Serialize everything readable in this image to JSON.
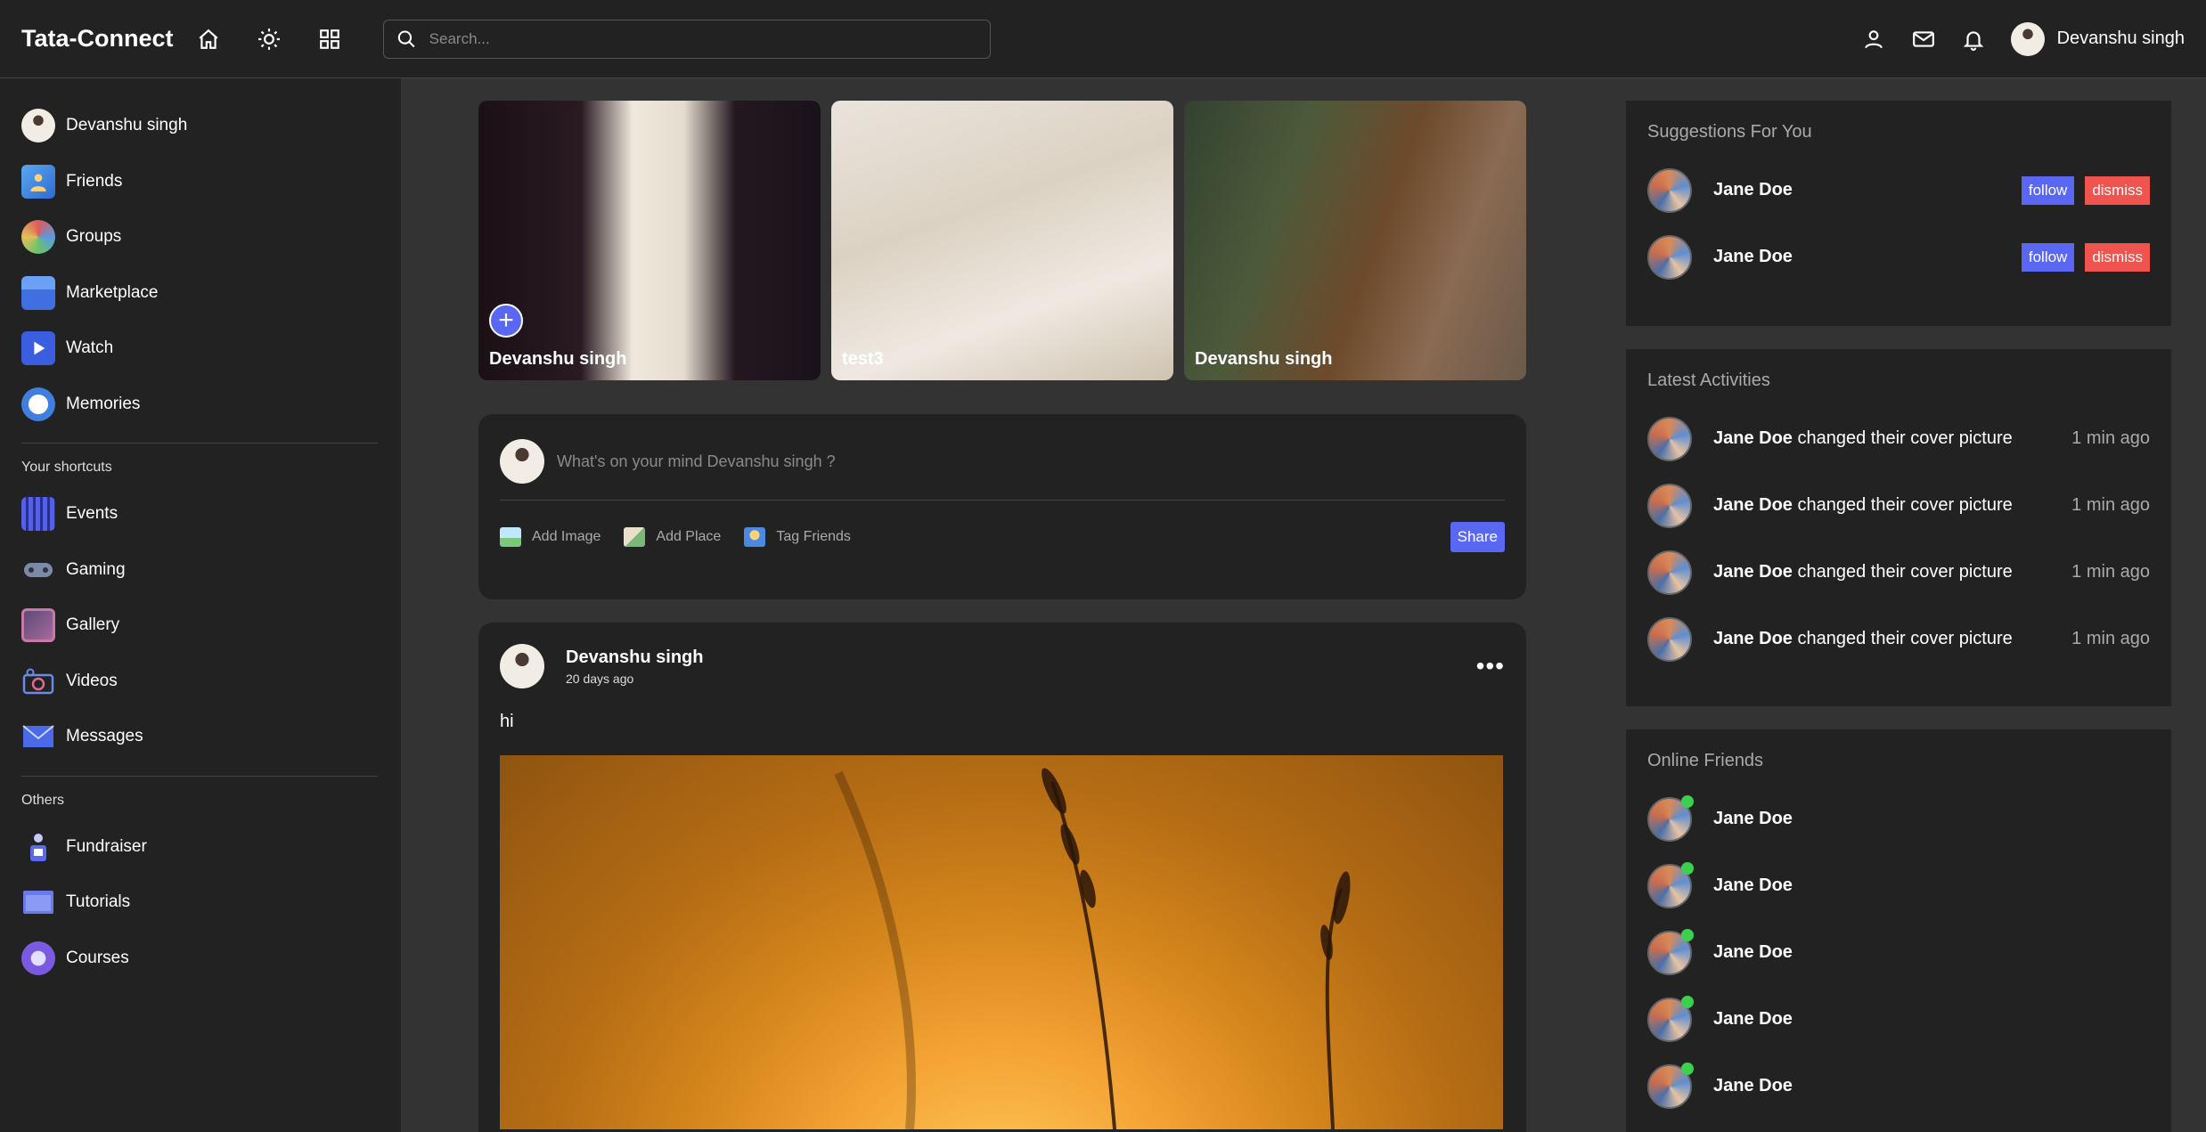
{
  "navbar": {
    "logo": "Tata-Connect",
    "search_placeholder": "Search...",
    "user_name": "Devanshu singh",
    "icons": [
      "home-icon",
      "sun-icon",
      "grid-icon",
      "search-icon",
      "person-icon",
      "mail-icon",
      "bell-icon"
    ]
  },
  "sidebar": {
    "top_items": [
      {
        "label": "Devanshu singh",
        "icon": "avatar"
      },
      {
        "label": "Friends",
        "icon": "friends-icon"
      },
      {
        "label": "Groups",
        "icon": "groups-icon"
      },
      {
        "label": "Marketplace",
        "icon": "marketplace-icon"
      },
      {
        "label": "Watch",
        "icon": "watch-icon"
      },
      {
        "label": "Memories",
        "icon": "memories-icon"
      }
    ],
    "shortcuts_title": "Your shortcuts",
    "shortcuts": [
      {
        "label": "Events",
        "icon": "events-icon"
      },
      {
        "label": "Gaming",
        "icon": "gaming-icon"
      },
      {
        "label": "Gallery",
        "icon": "gallery-icon"
      },
      {
        "label": "Videos",
        "icon": "videos-icon"
      },
      {
        "label": "Messages",
        "icon": "messages-icon"
      }
    ],
    "others_title": "Others",
    "others": [
      {
        "label": "Fundraiser",
        "icon": "fundraiser-icon"
      },
      {
        "label": "Tutorials",
        "icon": "tutorials-icon"
      },
      {
        "label": "Courses",
        "icon": "courses-icon"
      }
    ]
  },
  "stories": [
    {
      "name": "Devanshu singh"
    },
    {
      "name": "test3"
    },
    {
      "name": "Devanshu singh"
    }
  ],
  "composer": {
    "placeholder": "What's on your mind Devanshu singh ?",
    "add_image": "Add Image",
    "add_place": "Add Place",
    "tag_friends": "Tag Friends",
    "share": "Share"
  },
  "post": {
    "author": "Devanshu singh",
    "date": "20 days ago",
    "text": "hi",
    "more": "•••"
  },
  "suggestions": {
    "title": "Suggestions For You",
    "items": [
      {
        "name": "Jane Doe",
        "follow": "follow",
        "dismiss": "dismiss"
      },
      {
        "name": "Jane Doe",
        "follow": "follow",
        "dismiss": "dismiss"
      }
    ]
  },
  "activities": {
    "title": "Latest Activities",
    "items": [
      {
        "name": "Jane Doe",
        "action": "changed their cover picture",
        "time": "1 min ago"
      },
      {
        "name": "Jane Doe",
        "action": "changed their cover picture",
        "time": "1 min ago"
      },
      {
        "name": "Jane Doe",
        "action": "changed their cover picture",
        "time": "1 min ago"
      },
      {
        "name": "Jane Doe",
        "action": "changed their cover picture",
        "time": "1 min ago"
      }
    ]
  },
  "online": {
    "title": "Online Friends",
    "items": [
      {
        "name": "Jane Doe"
      },
      {
        "name": "Jane Doe"
      },
      {
        "name": "Jane Doe"
      },
      {
        "name": "Jane Doe"
      },
      {
        "name": "Jane Doe"
      }
    ]
  },
  "colors": {
    "accent": "#5a67f3",
    "danger": "#f0544f",
    "online": "#3dd04f",
    "panel": "#222222",
    "background": "#333333"
  }
}
